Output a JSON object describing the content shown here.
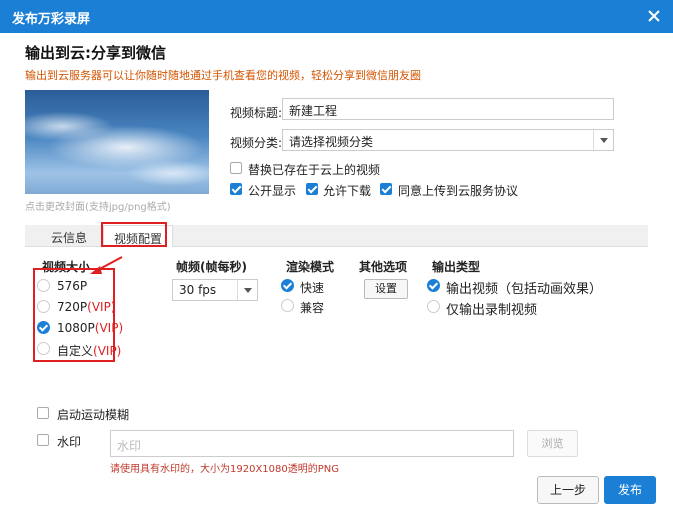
{
  "window": {
    "title": "发布万彩录屏"
  },
  "header": {
    "heading": "输出到云:分享到微信",
    "subtitle": "输出到云服务器可以让你随时随地通过手机查看您的视频，轻松分享到微信朋友圈"
  },
  "cover": {
    "hint": "点击更改封面(支持jpg/png格式)"
  },
  "form": {
    "title_label": "视频标题:",
    "title_value": "新建工程",
    "category_label": "视频分类:",
    "category_value": "请选择视频分类",
    "replace_label": "替换已存在于云上的视频",
    "replace_checked": false,
    "public_label": "公开显示",
    "public_checked": true,
    "download_label": "允许下载",
    "download_checked": true,
    "agree_label": "同意上传到云服务协议",
    "agree_checked": true
  },
  "tabs": [
    {
      "label": "云信息",
      "active": false
    },
    {
      "label": "视频配置",
      "active": true
    }
  ],
  "video_size": {
    "title": "视频大小",
    "options": [
      {
        "label": "576P",
        "vip": "",
        "checked": false
      },
      {
        "label": "720P",
        "vip": "(VIP)",
        "checked": false
      },
      {
        "label": "1080P",
        "vip": "(VIP)",
        "checked": true
      },
      {
        "label": "自定义",
        "vip": "(VIP)",
        "checked": false
      }
    ]
  },
  "frame_rate": {
    "title": "帧频(帧每秒)",
    "value": "30 fps"
  },
  "render_mode": {
    "title": "渲染模式",
    "options": [
      {
        "label": "快速",
        "checked": true
      },
      {
        "label": "兼容",
        "checked": false
      }
    ]
  },
  "other_options": {
    "title": "其他选项",
    "settings_button": "设置"
  },
  "output_type": {
    "title": "输出类型",
    "options": [
      {
        "label": "输出视频（包括动画效果）",
        "checked": true
      },
      {
        "label": "仅输出录制视频",
        "checked": false
      }
    ]
  },
  "motion_blur": {
    "label": "启动运动模糊",
    "checked": false
  },
  "watermark": {
    "label": "水印",
    "checked": false,
    "placeholder": "水印",
    "browse_button": "浏览",
    "hint": "请使用具有水印的，大小为1920X1080透明的PNG"
  },
  "footer": {
    "prev_button": "上一步",
    "publish_button": "发布"
  },
  "colors": {
    "accent": "#1b7fd6",
    "highlight": "#e02020",
    "subtitle": "#d35400"
  }
}
